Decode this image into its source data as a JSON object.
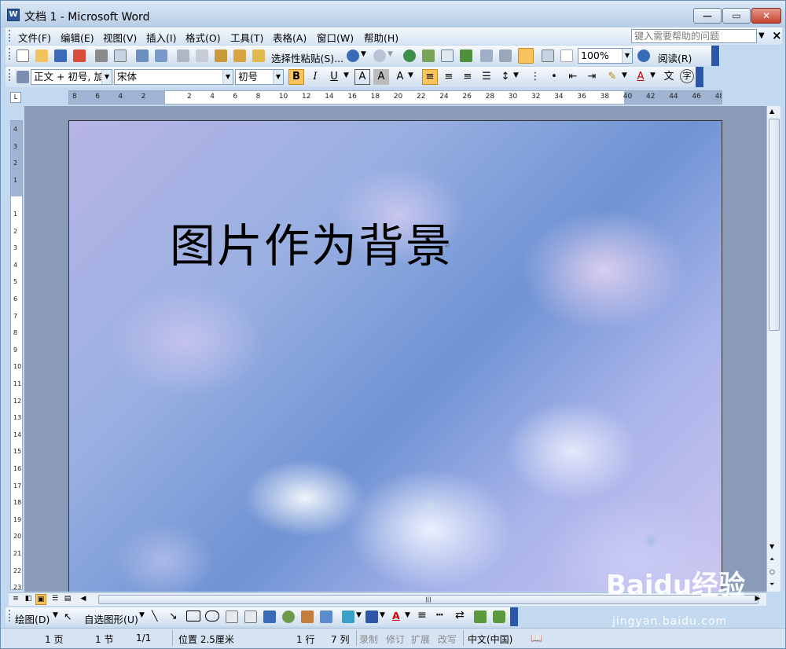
{
  "titlebar": {
    "icon": "word-doc-icon",
    "title": "文档 1 - Microsoft Word"
  },
  "menubar": {
    "items": [
      "文件(F)",
      "编辑(E)",
      "视图(V)",
      "插入(I)",
      "格式(O)",
      "工具(T)",
      "表格(A)",
      "窗口(W)",
      "帮助(H)"
    ],
    "help_placeholder": "键入需要帮助的问题"
  },
  "standard_toolbar": {
    "paste_special_label": "选择性粘贴(S)...",
    "zoom": "100%",
    "read_label": "阅读(R)"
  },
  "formatting_toolbar": {
    "style": "正文 + 初号, 加",
    "font": "宋体",
    "size": "初号",
    "bold_active": true,
    "align_left_active": true
  },
  "ruler": {
    "h_ticks": [
      "8",
      "6",
      "4",
      "2",
      "",
      "2",
      "4",
      "6",
      "8",
      "10",
      "12",
      "14",
      "16",
      "18",
      "20",
      "22",
      "24",
      "26",
      "28",
      "30",
      "32",
      "34",
      "36",
      "38",
      "40",
      "42",
      "44",
      "46",
      "48"
    ],
    "v_ticks": [
      "4",
      "3",
      "2",
      "1",
      "",
      "1",
      "2",
      "3",
      "4",
      "5",
      "6",
      "7",
      "8",
      "9",
      "10",
      "11",
      "12",
      "13",
      "14",
      "15",
      "16",
      "17",
      "18",
      "19",
      "20",
      "21",
      "22",
      "23"
    ]
  },
  "document": {
    "heading": "图片作为背景",
    "background": "hydrangea-flowers-image"
  },
  "draw_toolbar": {
    "draw_label": "绘图(D)",
    "autoshape_label": "自选图形(U)"
  },
  "statusbar": {
    "page": "1 页",
    "section": "1 节",
    "page_of": "1/1",
    "position": "位置 2.5厘米",
    "line": "1 行",
    "col": "7 列",
    "rec": "录制",
    "trk": "修订",
    "ext": "扩展",
    "ovr": "改写",
    "language": "中文(中国)"
  },
  "watermark": {
    "logo": "Baidu经验",
    "sub": "jingyan.baidu.com"
  },
  "colors": {
    "accent": "#2c56a7",
    "active": "#f9c35d",
    "close": "#c5432f"
  }
}
